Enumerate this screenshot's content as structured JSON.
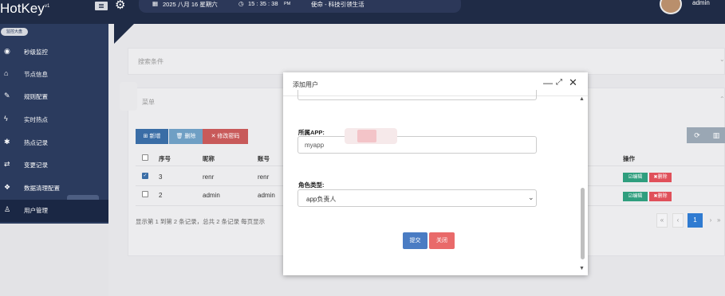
{
  "topbar": {
    "brand": "HotKey",
    "brand_version": "v1",
    "menu_icon": "hamburger-icon",
    "settings_icon": "gear-icon",
    "date": "2025 八月 16 星期六",
    "time": "15 : 35 : 38",
    "time_suffix": "PM",
    "mission": "使命 - 科技引领生活",
    "username": "admin"
  },
  "sidebar": {
    "section_badge": "监控大盘",
    "items": [
      {
        "label": "秒级监控",
        "icon": "eye-icon"
      },
      {
        "label": "节点信息",
        "icon": "home-icon"
      },
      {
        "label": "规则配置",
        "icon": "wand-icon"
      },
      {
        "label": "实时热点",
        "icon": "bolt-icon"
      },
      {
        "label": "热点记录",
        "icon": "snowflake-icon"
      },
      {
        "label": "变更记录",
        "icon": "exchange-icon"
      },
      {
        "label": "数据清理配置",
        "icon": "cubes-icon"
      },
      {
        "label": "用户管理",
        "icon": "user-icon"
      }
    ]
  },
  "search_panel": {
    "title": "搜索条件"
  },
  "list_panel": {
    "title": "菜单"
  },
  "toolbar": {
    "add": "新增",
    "delete": "删除",
    "change_password": "修改密码",
    "refresh_icon": "refresh-icon",
    "columns_icon": "columns-icon"
  },
  "table": {
    "headers": [
      "序号",
      "昵称",
      "账号",
      "操作"
    ],
    "rows": [
      {
        "checked": true,
        "index": "3",
        "nickname": "renr",
        "account": "renr"
      },
      {
        "checked": false,
        "index": "2",
        "nickname": "admin",
        "account": "admin"
      }
    ],
    "edit_label": "编辑",
    "delete_label": "删除"
  },
  "pagination": {
    "info": "显示第 1 到第 2 条记录，总共 2 条记录 每页显示",
    "first": "«",
    "prev": "‹",
    "current": "1",
    "next": "›",
    "last": "»"
  },
  "modal": {
    "title": "添加用户",
    "app_label": "所属APP:",
    "app_value": "myapp",
    "role_label": "角色类型:",
    "role_value": "app负责人",
    "submit": "提交",
    "close": "关闭"
  },
  "colors": {
    "topbar": "#1f2b46",
    "sidebar": "#2b3b5e",
    "primary": "#3a6da6",
    "danger": "#e0505a",
    "success": "#2f9e7e"
  }
}
